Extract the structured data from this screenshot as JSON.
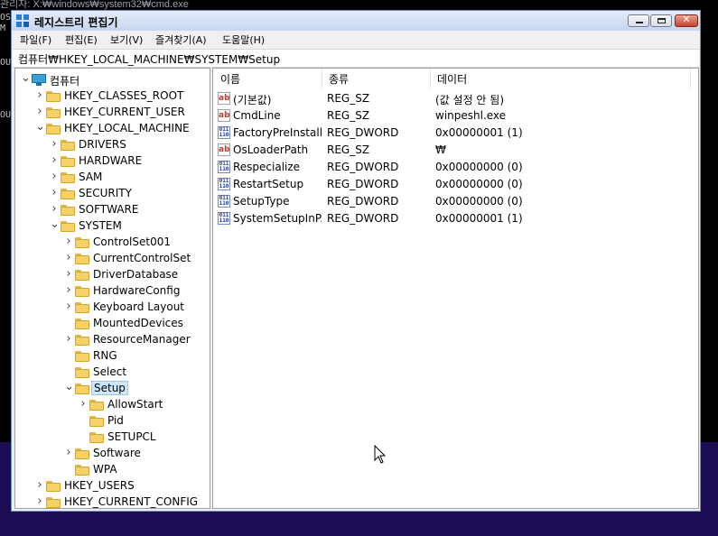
{
  "background": {
    "cmd_title": "관리자: X:₩windows₩system32₩cmd.exe",
    "cmd_fragments": [
      "OS",
      "M",
      "OU",
      "OU"
    ]
  },
  "window": {
    "title": "레지스트리 편집기",
    "controls": {
      "minimize": "",
      "maximize": "",
      "close": "✕"
    }
  },
  "menu": [
    "파일(F)",
    "편집(E)",
    "보기(V)",
    "즐겨찾기(A)",
    "도움말(H)"
  ],
  "address": "컴퓨터₩HKEY_LOCAL_MACHINE₩SYSTEM₩Setup",
  "tree": [
    {
      "label": "컴퓨터",
      "depth": 0,
      "chevron": "down",
      "icon": "pc"
    },
    {
      "label": "HKEY_CLASSES_ROOT",
      "depth": 1,
      "chevron": "right",
      "icon": "folder"
    },
    {
      "label": "HKEY_CURRENT_USER",
      "depth": 1,
      "chevron": "right",
      "icon": "folder"
    },
    {
      "label": "HKEY_LOCAL_MACHINE",
      "depth": 1,
      "chevron": "down",
      "icon": "folder"
    },
    {
      "label": "DRIVERS",
      "depth": 2,
      "chevron": "right",
      "icon": "folder"
    },
    {
      "label": "HARDWARE",
      "depth": 2,
      "chevron": "right",
      "icon": "folder"
    },
    {
      "label": "SAM",
      "depth": 2,
      "chevron": "right",
      "icon": "folder"
    },
    {
      "label": "SECURITY",
      "depth": 2,
      "chevron": "right",
      "icon": "folder"
    },
    {
      "label": "SOFTWARE",
      "depth": 2,
      "chevron": "right",
      "icon": "folder"
    },
    {
      "label": "SYSTEM",
      "depth": 2,
      "chevron": "down",
      "icon": "folder"
    },
    {
      "label": "ControlSet001",
      "depth": 3,
      "chevron": "right",
      "icon": "folder"
    },
    {
      "label": "CurrentControlSet",
      "depth": 3,
      "chevron": "right",
      "icon": "folder"
    },
    {
      "label": "DriverDatabase",
      "depth": 3,
      "chevron": "right",
      "icon": "folder"
    },
    {
      "label": "HardwareConfig",
      "depth": 3,
      "chevron": "right",
      "icon": "folder"
    },
    {
      "label": "Keyboard Layout",
      "depth": 3,
      "chevron": "right",
      "icon": "folder"
    },
    {
      "label": "MountedDevices",
      "depth": 3,
      "chevron": "none",
      "icon": "folder"
    },
    {
      "label": "ResourceManager",
      "depth": 3,
      "chevron": "right",
      "icon": "folder"
    },
    {
      "label": "RNG",
      "depth": 3,
      "chevron": "none",
      "icon": "folder"
    },
    {
      "label": "Select",
      "depth": 3,
      "chevron": "none",
      "icon": "folder"
    },
    {
      "label": "Setup",
      "depth": 3,
      "chevron": "down",
      "icon": "folder",
      "selected": true
    },
    {
      "label": "AllowStart",
      "depth": 4,
      "chevron": "right",
      "icon": "folder"
    },
    {
      "label": "Pid",
      "depth": 4,
      "chevron": "none",
      "icon": "folder"
    },
    {
      "label": "SETUPCL",
      "depth": 4,
      "chevron": "none",
      "icon": "folder"
    },
    {
      "label": "Software",
      "depth": 3,
      "chevron": "right",
      "icon": "folder"
    },
    {
      "label": "WPA",
      "depth": 3,
      "chevron": "none",
      "icon": "folder"
    },
    {
      "label": "HKEY_USERS",
      "depth": 1,
      "chevron": "right",
      "icon": "folder"
    },
    {
      "label": "HKEY_CURRENT_CONFIG",
      "depth": 1,
      "chevron": "right",
      "icon": "folder"
    }
  ],
  "list": {
    "columns": [
      "이름",
      "종류",
      "데이터"
    ],
    "rows": [
      {
        "icon": "ab",
        "name": "(기본값)",
        "type": "REG_SZ",
        "data": "(값 설정 안 됨)"
      },
      {
        "icon": "ab",
        "name": "CmdLine",
        "type": "REG_SZ",
        "data": "winpeshl.exe"
      },
      {
        "icon": "dword",
        "name": "FactoryPreInstall...",
        "type": "REG_DWORD",
        "data": "0x00000001 (1)"
      },
      {
        "icon": "ab",
        "name": "OsLoaderPath",
        "type": "REG_SZ",
        "data": "₩"
      },
      {
        "icon": "dword",
        "name": "Respecialize",
        "type": "REG_DWORD",
        "data": "0x00000000 (0)"
      },
      {
        "icon": "dword",
        "name": "RestartSetup",
        "type": "REG_DWORD",
        "data": "0x00000000 (0)"
      },
      {
        "icon": "dword",
        "name": "SetupType",
        "type": "REG_DWORD",
        "data": "0x00000000 (0)"
      },
      {
        "icon": "dword",
        "name": "SystemSetupInP...",
        "type": "REG_DWORD",
        "data": "0x00000001 (1)"
      }
    ]
  },
  "icons": {
    "ab": "ab",
    "dword": "011 110"
  },
  "colors": {
    "selection": "#cce8ff",
    "folder": "#f7d068",
    "desktop": "#1c0c54"
  }
}
